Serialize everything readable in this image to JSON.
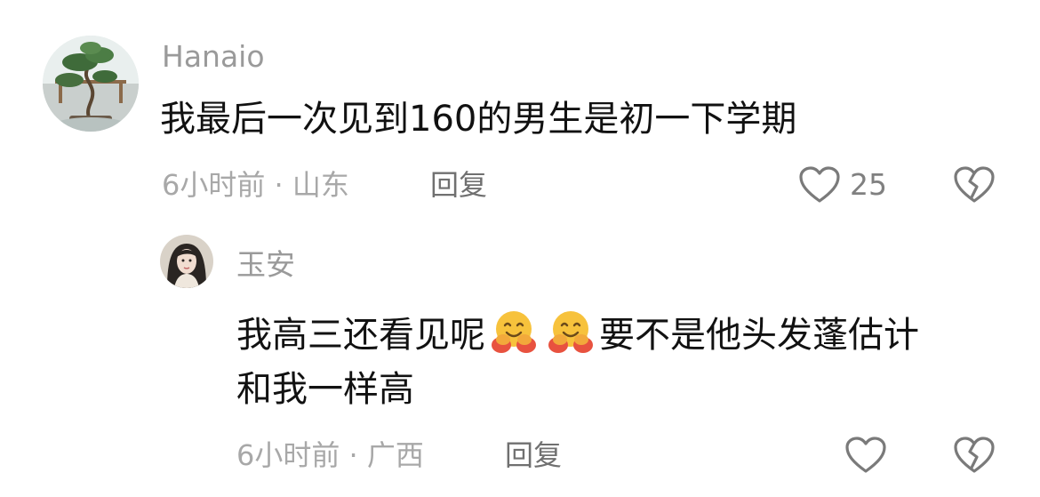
{
  "colors": {
    "text_primary": "#111111",
    "text_secondary": "#9a9a9a",
    "icon_stroke": "#7a7a7a"
  },
  "comment": {
    "username": "Hanaio",
    "text": "我最后一次见到160的男生是初一下学期",
    "time": "6小时前",
    "separator": "·",
    "location": "山东",
    "reply_label": "回复",
    "like_count": "25",
    "avatar_icon": "bonsai-tree-avatar"
  },
  "reply": {
    "username": "玉安",
    "text_part1": "我高三还看见呢",
    "text_part2": "要不是他头发蓬估计",
    "text_line2": "和我一样高",
    "emoji_name": "hugging-face-emoji",
    "time": "6小时前",
    "separator": "·",
    "location": "广西",
    "reply_label": "回复",
    "avatar_icon": "girl-portrait-avatar"
  },
  "icons": {
    "like": "heart-outline-icon",
    "dislike": "broken-heart-icon"
  }
}
